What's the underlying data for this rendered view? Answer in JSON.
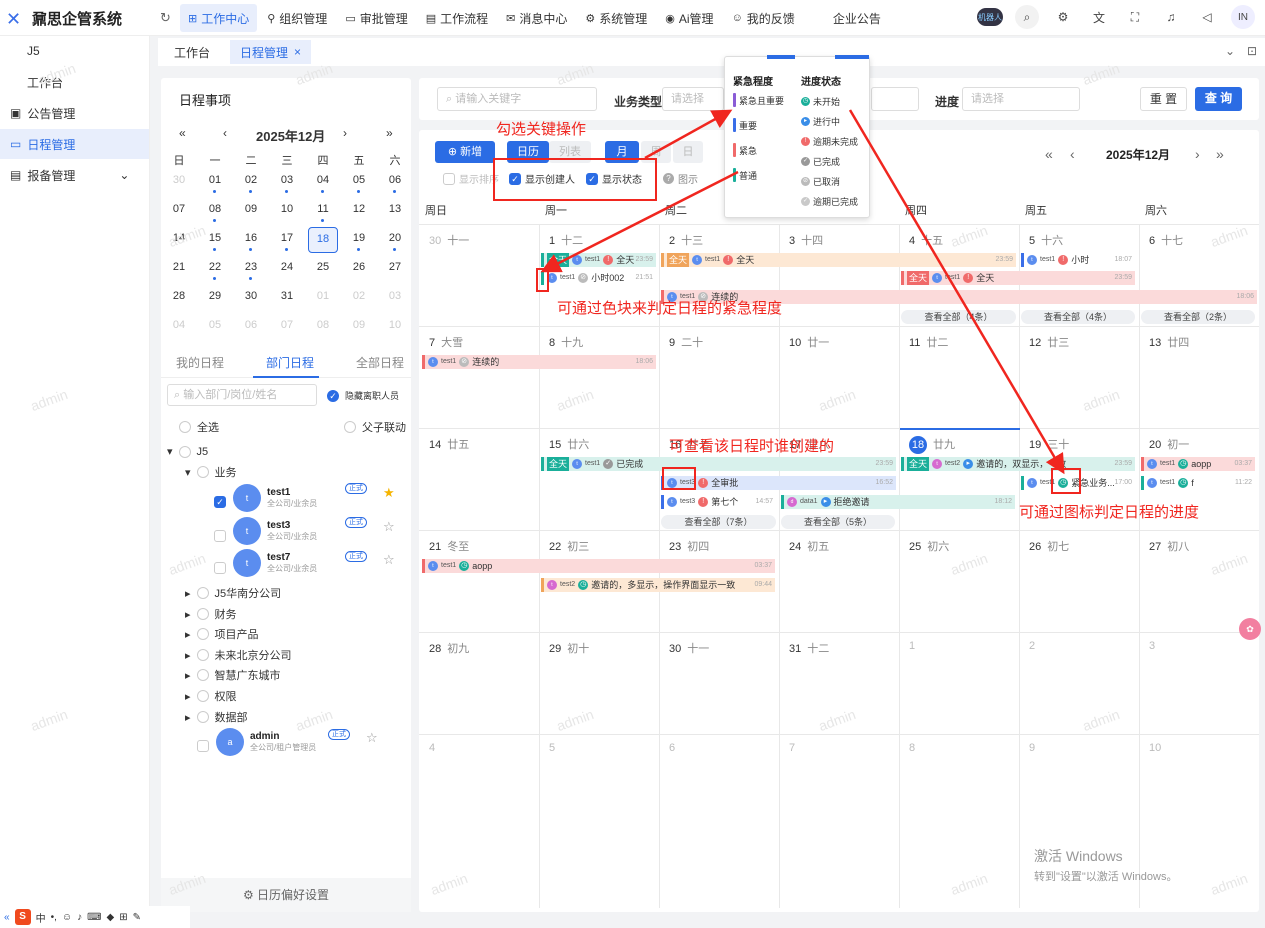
{
  "app": {
    "title": "鼐思企管系统"
  },
  "topnav": [
    "工作中心",
    "组织管理",
    "审批管理",
    "工作流程",
    "消息中心",
    "系统管理",
    "Ai管理",
    "我的反馈",
    "企业公告"
  ],
  "topright": {
    "avatar": "IN",
    "robot": "机器人"
  },
  "sidebar": {
    "items": [
      "J5",
      "工作台",
      "公告管理",
      "日程管理",
      "报备管理"
    ]
  },
  "tabs": [
    "工作台",
    "日程管理"
  ],
  "left": {
    "title": "日程事项",
    "month": "2025年12月",
    "weekdays": [
      "日",
      "一",
      "二",
      "三",
      "四",
      "五",
      "六"
    ],
    "days": [
      "30",
      "01",
      "02",
      "03",
      "04",
      "05",
      "06",
      "07",
      "08",
      "09",
      "10",
      "11",
      "12",
      "13",
      "14",
      "15",
      "16",
      "17",
      "18",
      "19",
      "20",
      "21",
      "22",
      "23",
      "24",
      "25",
      "26",
      "27",
      "28",
      "29",
      "30",
      "31",
      "01",
      "02",
      "03",
      "04",
      "05",
      "06",
      "07",
      "08",
      "09",
      "10"
    ],
    "tabs": [
      "我的日程",
      "部门日程",
      "全部日程"
    ],
    "search_placeholder": "输入部门/岗位/姓名",
    "hide_resigned": "隐藏离职人员",
    "select_all": "全选",
    "parent_link": "父子联动",
    "root": "J5",
    "dept": "业务",
    "people": [
      {
        "name": "test1",
        "role": "全公司/业余员",
        "tag": "正式"
      },
      {
        "name": "test3",
        "role": "全公司/业余员",
        "tag": "正式"
      },
      {
        "name": "test7",
        "role": "全公司/业余员",
        "tag": "正式"
      }
    ],
    "branches": [
      "J5华南分公司",
      "财务",
      "项目产品",
      "未来北京分公司",
      "智慧广东城市",
      "权限",
      "数据部"
    ],
    "admin": {
      "name": "admin",
      "role": "全公司/租户管理员",
      "tag": "正式"
    },
    "footer": "日历偏好设置"
  },
  "filter": {
    "keyword_placeholder": "请输入关键字",
    "type_label": "业务类型",
    "type_placeholder": "请选择",
    "progress_label": "进度",
    "progress_placeholder": "请选择",
    "reset": "重 置",
    "query": "查 询"
  },
  "toolbar": {
    "add": "新增",
    "calendar": "日历",
    "list": "列表",
    "month": "月",
    "week": "周",
    "day": "日",
    "show_sort": "显示排序",
    "show_creator": "显示创建人",
    "show_status": "显示状态",
    "legend": "图示",
    "month_title": "2025年12月"
  },
  "weekheads": [
    "周日",
    "周一",
    "周二",
    "周三",
    "周四",
    "周五",
    "周六"
  ],
  "cells": [
    [
      "30",
      "十一"
    ],
    [
      "1",
      "十二"
    ],
    [
      "2",
      "十三"
    ],
    [
      "3",
      "十四"
    ],
    [
      "4",
      "十五"
    ],
    [
      "5",
      "十六"
    ],
    [
      "6",
      "十七"
    ],
    [
      "7",
      "大雪"
    ],
    [
      "8",
      "十九"
    ],
    [
      "9",
      "二十"
    ],
    [
      "10",
      "廿一"
    ],
    [
      "11",
      "廿二"
    ],
    [
      "12",
      "廿三"
    ],
    [
      "13",
      "廿四"
    ],
    [
      "14",
      "廿五"
    ],
    [
      "15",
      "廿六"
    ],
    [
      "16",
      "廿七"
    ],
    [
      "17",
      "廿八"
    ],
    [
      "18",
      "廿九"
    ],
    [
      "19",
      "三十"
    ],
    [
      "20",
      "初一"
    ],
    [
      "21",
      "冬至"
    ],
    [
      "22",
      "初三"
    ],
    [
      "23",
      "初四"
    ],
    [
      "24",
      "初五"
    ],
    [
      "25",
      "初六"
    ],
    [
      "26",
      "初七"
    ],
    [
      "27",
      "初八"
    ],
    [
      "28",
      "初九"
    ],
    [
      "29",
      "初十"
    ],
    [
      "30",
      "十一"
    ],
    [
      "31",
      "十二"
    ],
    [
      "1",
      ""
    ],
    [
      "2",
      ""
    ],
    [
      "3",
      ""
    ],
    [
      "4",
      ""
    ],
    [
      "5",
      ""
    ],
    [
      "6",
      ""
    ],
    [
      "7",
      ""
    ],
    [
      "8",
      ""
    ],
    [
      "9",
      ""
    ],
    [
      "10",
      ""
    ]
  ],
  "events": {
    "allday": "全天",
    "e1": "全天",
    "e1t": "23:59",
    "e2": "小时002",
    "e2t": "21:51",
    "e3": "全天",
    "e3t": "23:59",
    "e4": "连续的",
    "e4t": "18:06",
    "e5": "全天",
    "e5t": "23:59",
    "e6": "小时",
    "e6t": "18:07",
    "e7": "连续的",
    "e7t": "18:06",
    "e8": "已完成",
    "e8t": "23:59",
    "e9": "全审批",
    "e9t": "16:52",
    "e10": "第七个",
    "e10t": "14:57",
    "e11": "拒绝邀请",
    "e11t": "18:12",
    "e12": "邀请的，双显示，一致",
    "e12t": "23:59",
    "e13": "紧急业务...",
    "e13t": "17:00",
    "e14": "aopp",
    "e14t": "03:37",
    "e15": "f",
    "e15t": "11:22",
    "e16": "aopp",
    "e16t": "03:37",
    "e17": "邀请的，多显示，操作界面显示一致",
    "e17t": "09:44",
    "user1": "test1",
    "user2": "test2",
    "user3": "data1",
    "user4": "test3"
  },
  "more": [
    "查看全部（4条）",
    "查看全部（4条）",
    "查看全部（2条）",
    "查看全部（7条）",
    "查看全部（5条）"
  ],
  "legend": {
    "urgency_title": "紧急程度",
    "status_title": "进度状态",
    "urgency": [
      {
        "label": "紧急且重要",
        "color": "#8a5cd6"
      },
      {
        "label": "重要",
        "color": "#3a6ee8"
      },
      {
        "label": "紧急",
        "color": "#f06a6a"
      },
      {
        "label": "普通",
        "color": "#1aaf9a"
      }
    ],
    "status": [
      {
        "label": "未开始",
        "color": "#1aaf9a"
      },
      {
        "label": "进行中",
        "color": "#3a8ee8"
      },
      {
        "label": "逾期未完成",
        "color": "#f06a6a"
      },
      {
        "label": "已完成",
        "color": "#999999"
      },
      {
        "label": "已取消",
        "color": "#bbbbbb"
      },
      {
        "label": "逾期已完成",
        "color": "#c9c9c9"
      }
    ]
  },
  "annotations": {
    "a1": "勾选关键操作",
    "a2": "可通过色块来判定日程的紧急程度",
    "a3": "可查看该日程时谁创建的",
    "a4": "可通过图标判定日程的进度"
  },
  "watermark": "admin",
  "windows": {
    "line1": "激活 Windows",
    "line2": "转到\"设置\"以激活 Windows。"
  },
  "taskbar": "中"
}
